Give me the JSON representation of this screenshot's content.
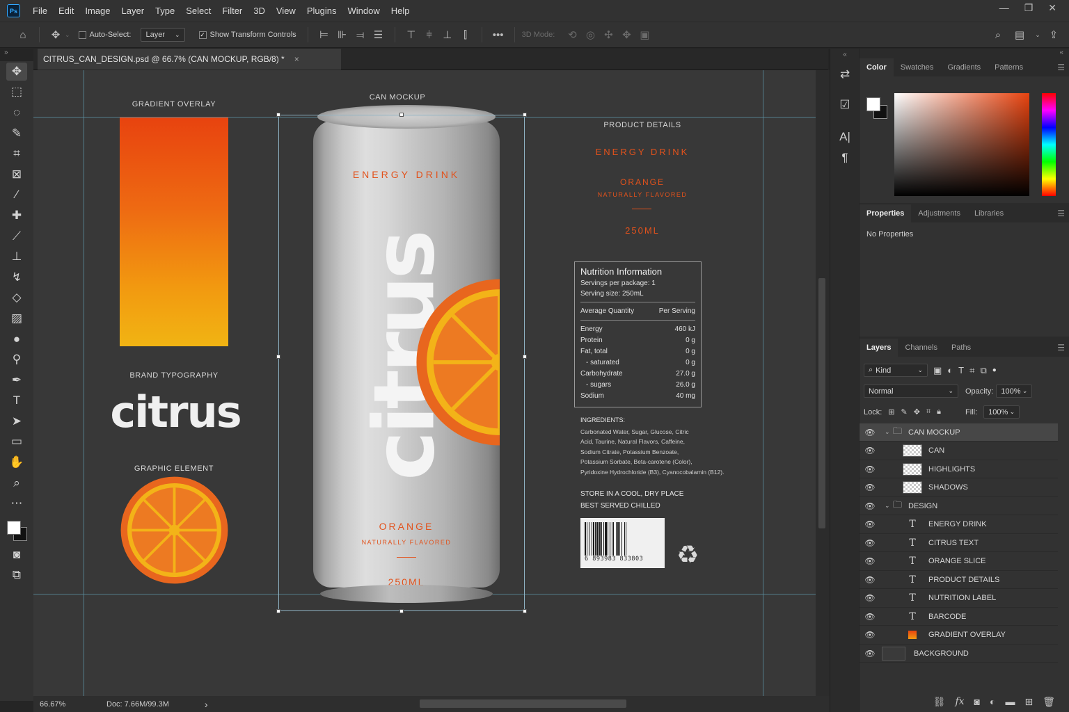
{
  "menu": [
    "File",
    "Edit",
    "Image",
    "Layer",
    "Type",
    "Select",
    "Filter",
    "3D",
    "View",
    "Plugins",
    "Window",
    "Help"
  ],
  "app_logo": "Ps",
  "options": {
    "auto_select": "Auto-Select:",
    "layer_dropdown": "Layer",
    "show_transform": "Show Transform Controls",
    "mode_3d": "3D Mode:",
    "more": "•••"
  },
  "document_tab": {
    "title": "CITRUS_CAN_DESIGN.psd @ 66.7% (CAN MOCKUP, RGB/8) *",
    "close": "×"
  },
  "canvas": {
    "gradient_overlay_label": "GRADIENT OVERLAY",
    "can_mockup_label": "CAN MOCKUP",
    "product_details_label": "PRODUCT DETAILS",
    "brand_typography_label": "BRAND TYPOGRAPHY",
    "graphic_element_label": "GRAPHIC ELEMENT",
    "brand_word": "citrus",
    "can": {
      "title": "ENERGY DRINK",
      "brand": "citrus",
      "flavor": "ORANGE",
      "flavor_note": "NATURALLY FLAVORED",
      "volume": "250ML"
    },
    "product_details": {
      "title": "ENERGY DRINK",
      "flavor": "ORANGE",
      "flavor_note": "NATURALLY FLAVORED",
      "volume": "250ML"
    },
    "nutrition": {
      "title": "Nutrition Information",
      "servings": "Servings per package: 1",
      "serving_size": "Serving size: 250mL",
      "col1": "Average Quantity",
      "col2": "Per Serving",
      "rows": [
        {
          "label": "Energy",
          "value": "460 kJ"
        },
        {
          "label": "Protein",
          "value": "0 g"
        },
        {
          "label": "Fat, total",
          "value": "0 g"
        },
        {
          "label": "- saturated",
          "value": "0 g"
        },
        {
          "label": "Carbohydrate",
          "value": "27.0 g"
        },
        {
          "label": "- sugars",
          "value": "26.0 g"
        },
        {
          "label": "Sodium",
          "value": "40 mg"
        }
      ]
    },
    "ingredients": {
      "heading": "INGREDIENTS:",
      "lines": [
        "Carbonated Water, Sugar, Glucose, Citric",
        "Acid, Taurine, Natural Flavors, Caffeine,",
        "Sodium Citrate, Potassium Benzoate,",
        "Potassium Sorbate, Beta-carotene (Color),",
        "Pyridoxine Hydrochloride (B3), Cyanocobalamin (B12)."
      ]
    },
    "store": [
      "STORE IN A COOL, DRY PLACE",
      "BEST SERVED CHILLED"
    ],
    "barcode_number": "6 893983 833803",
    "recycle_symbol": "♻"
  },
  "status": {
    "zoom": "66.67%",
    "doc": "Doc: 7.66M/99.3M",
    "arrow": "›"
  },
  "color_panel": {
    "tabs": [
      "Color",
      "Swatches",
      "Gradients",
      "Patterns"
    ]
  },
  "properties_panel": {
    "tabs": [
      "Properties",
      "Adjustments",
      "Libraries"
    ],
    "empty": "No Properties"
  },
  "layers_panel": {
    "tabs": [
      "Layers",
      "Channels",
      "Paths"
    ],
    "filter_kind": "Kind",
    "blend_mode": "Normal",
    "opacity_label": "Opacity:",
    "opacity_value": "100%",
    "lock_label": "Lock:",
    "fill_label": "Fill:",
    "fill_value": "100%",
    "layers": [
      {
        "name": "CAN MOCKUP",
        "kind": "group",
        "indent": 0,
        "selected": true
      },
      {
        "name": "CAN",
        "kind": "pixel",
        "indent": 1
      },
      {
        "name": "HIGHLIGHTS",
        "kind": "pixel",
        "indent": 1
      },
      {
        "name": "SHADOWS",
        "kind": "pixel",
        "indent": 1
      },
      {
        "name": "DESIGN",
        "kind": "group",
        "indent": 0
      },
      {
        "name": "ENERGY DRINK",
        "kind": "text",
        "indent": 1
      },
      {
        "name": "CITRUS TEXT",
        "kind": "text",
        "indent": 1
      },
      {
        "name": "ORANGE SLICE",
        "kind": "text",
        "indent": 1
      },
      {
        "name": "PRODUCT DETAILS",
        "kind": "text",
        "indent": 1
      },
      {
        "name": "NUTRITION LABEL",
        "kind": "text",
        "indent": 1
      },
      {
        "name": "BARCODE",
        "kind": "text",
        "indent": 1
      },
      {
        "name": "GRADIENT OVERLAY",
        "kind": "fill",
        "indent": 1
      },
      {
        "name": "BACKGROUND",
        "kind": "background",
        "indent": -1
      }
    ]
  },
  "colors": {
    "accent_orange": "#e2521c",
    "ui_dark": "#323232",
    "canvas_bg": "#383838"
  }
}
